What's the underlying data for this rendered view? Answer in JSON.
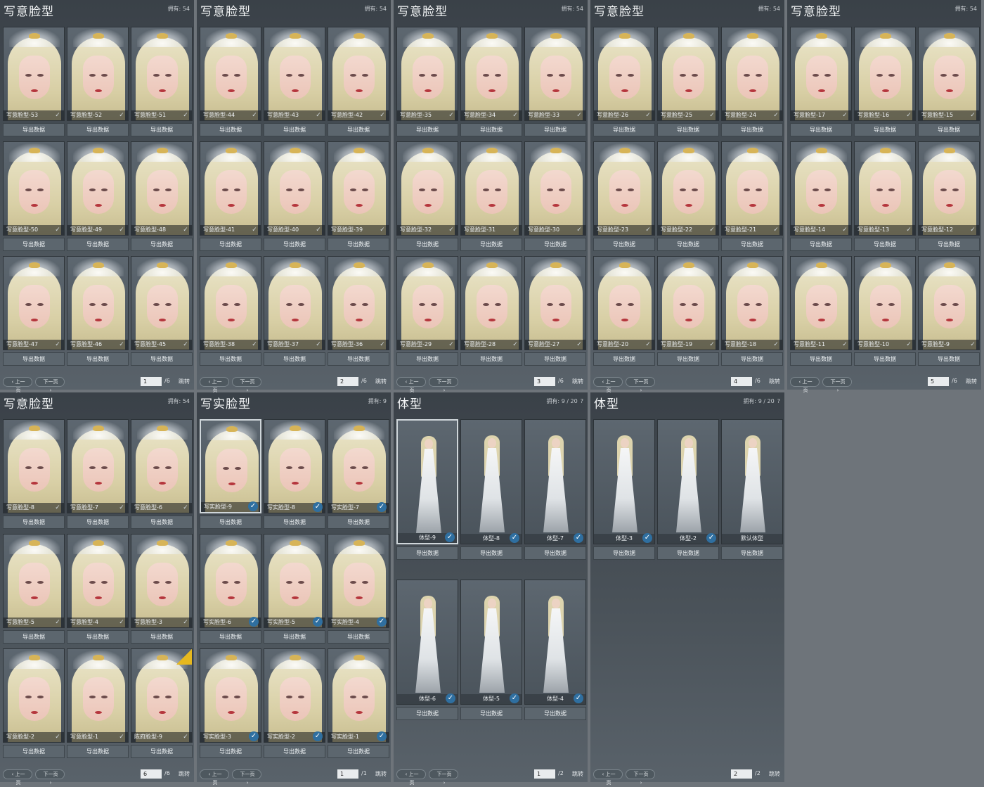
{
  "labels": {
    "export": "导出数据",
    "prev": "上一页",
    "next": "下一页",
    "jump": "跳转",
    "owned_prefix": "拥有:"
  },
  "panels": [
    {
      "title": "写意脸型",
      "owned": "54",
      "page": "1",
      "total": "/6",
      "cards": [
        "写意脸型-53",
        "写意脸型-52",
        "写意脸型-51",
        "写意脸型-50",
        "写意脸型-49",
        "写意脸型-48",
        "写意脸型-47",
        "写意脸型-46",
        "写意脸型-45"
      ]
    },
    {
      "title": "写意脸型",
      "owned": "54",
      "page": "2",
      "total": "/6",
      "cards": [
        "写意脸型-44",
        "写意脸型-43",
        "写意脸型-42",
        "写意脸型-41",
        "写意脸型-40",
        "写意脸型-39",
        "写意脸型-38",
        "写意脸型-37",
        "写意脸型-36"
      ]
    },
    {
      "title": "写意脸型",
      "owned": "54",
      "page": "3",
      "total": "/6",
      "cards": [
        "写意脸型-35",
        "写意脸型-34",
        "写意脸型-33",
        "写意脸型-32",
        "写意脸型-31",
        "写意脸型-30",
        "写意脸型-29",
        "写意脸型-28",
        "写意脸型-27"
      ]
    },
    {
      "title": "写意脸型",
      "owned": "54",
      "page": "4",
      "total": "/6",
      "cards": [
        "写意脸型-26",
        "写意脸型-25",
        "写意脸型-24",
        "写意脸型-23",
        "写意脸型-22",
        "写意脸型-21",
        "写意脸型-20",
        "写意脸型-19",
        "写意脸型-18"
      ]
    },
    {
      "title": "写意脸型",
      "owned": "54",
      "page": "5",
      "total": "/6",
      "cards": [
        "写意脸型-17",
        "写意脸型-16",
        "写意脸型-15",
        "写意脸型-14",
        "写意脸型-13",
        "写意脸型-12",
        "写意脸型-11",
        "写意脸型-10",
        "写意脸型-9"
      ]
    },
    {
      "title": "写意脸型",
      "owned": "54",
      "page": "6",
      "total": "/6",
      "cards": [
        "写意脸型-8",
        "写意脸型-7",
        "写意脸型-6",
        "写意脸型-5",
        "写意脸型-4",
        "写意脸型-3",
        "写意脸型-2",
        "写意脸型-1",
        "陈府脸型-9"
      ]
    },
    {
      "title": "写实脸型",
      "owned": "9",
      "page": "1",
      "total": "/1",
      "cards": [
        "写实脸型-9",
        "写实脸型-8",
        "写实脸型-7",
        "写实脸型-6",
        "写实脸型-5",
        "写实脸型-4",
        "写实脸型-3",
        "写实脸型-2",
        "写实脸型-1"
      ]
    },
    {
      "title": "体型",
      "owned": "9 / 20",
      "help": "?",
      "page": "1",
      "total": "/2",
      "cards": [
        "体型-9",
        "体型-8",
        "体型-7",
        "体型-6",
        "体型-5",
        "体型-4"
      ]
    },
    {
      "title": "体型",
      "owned": "9 / 20",
      "help": "?",
      "page": "2",
      "total": "/2",
      "cards": [
        "体型-3",
        "体型-2",
        "默认体型"
      ]
    }
  ],
  "accent_colors": {
    "selected_check": "#2f6fa0",
    "new_badge": "#e6b81f"
  },
  "icons": {
    "owned_check": "check-icon",
    "new_tag": "new-badge-icon"
  }
}
